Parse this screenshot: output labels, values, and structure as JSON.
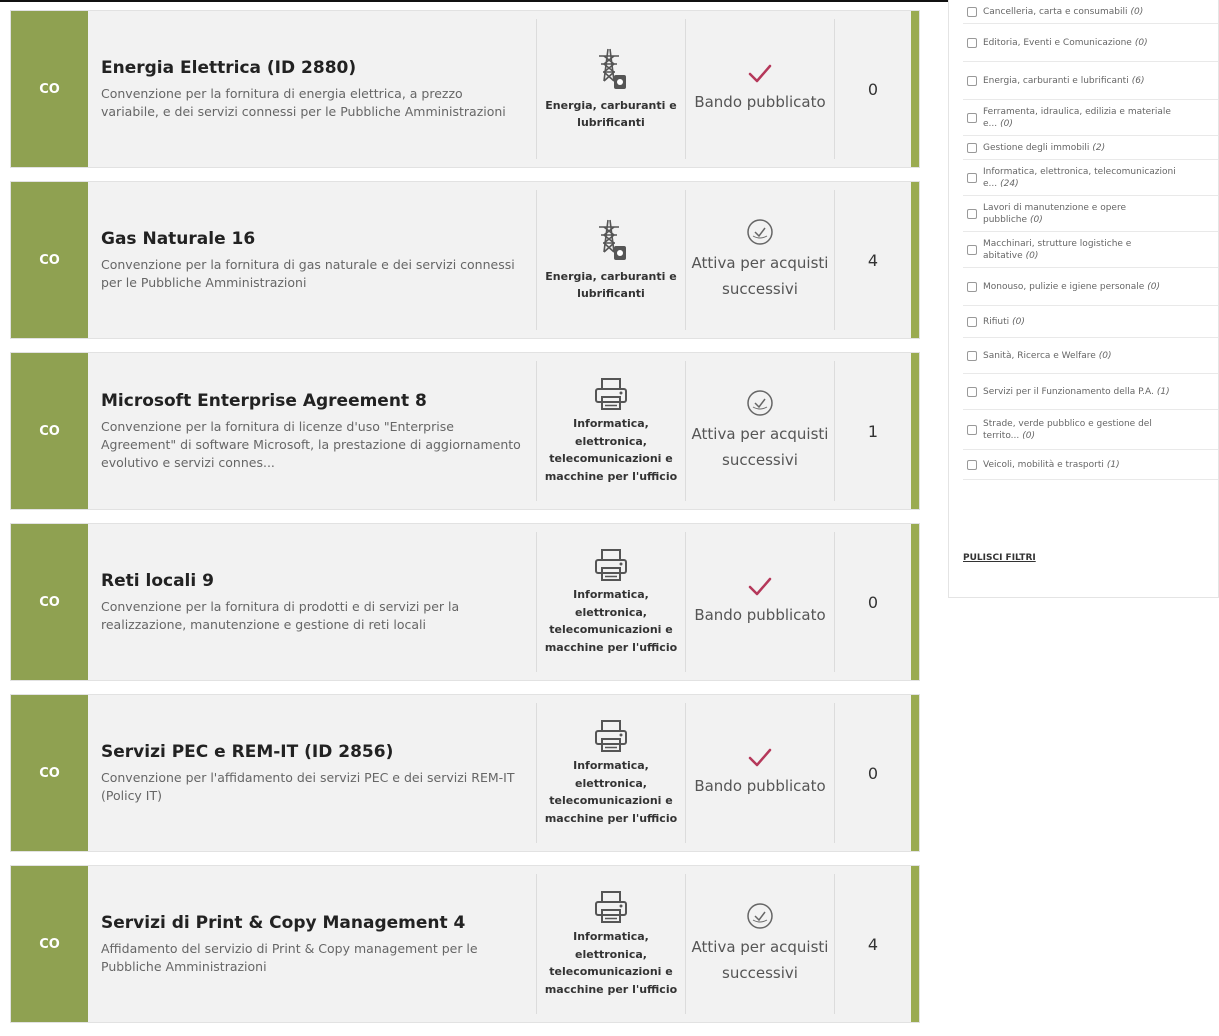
{
  "results": [
    {
      "type_code": "CO",
      "title": "Energia Elettrica (ID 2880)",
      "description": "Convenzione per la fornitura di energia elettrica, a prezzo variabile, e dei servizi connessi per le Pubbliche Amministrazioni",
      "category_icon": "power-pylon-icon",
      "category": "Energia, carburanti e lubrificanti",
      "status_icon": "check-icon",
      "status": "Bando pubblicato",
      "count": "0"
    },
    {
      "type_code": "CO",
      "title": "Gas Naturale 16",
      "description": "Convenzione per la fornitura di gas naturale e dei servizi connessi per le Pubbliche Amministrazioni",
      "category_icon": "power-pylon-icon",
      "category": "Energia, carburanti e lubrificanti",
      "status_icon": "active-badge-icon",
      "status": "Attiva per acquisti successivi",
      "count": "4"
    },
    {
      "type_code": "CO",
      "title": "Microsoft Enterprise Agreement 8",
      "description": "Convenzione per la fornitura di licenze d'uso \"Enterprise Agreement\" di software Microsoft, la prestazione di aggiornamento evolutivo e servizi connes...",
      "category_icon": "printer-icon",
      "category": "Informatica, elettronica, telecomunicazioni e macchine per l'ufficio",
      "status_icon": "active-badge-icon",
      "status": "Attiva per acquisti successivi",
      "count": "1"
    },
    {
      "type_code": "CO",
      "title": "Reti locali 9",
      "description": "Convenzione per la fornitura di prodotti e di servizi per la realizzazione, manutenzione e gestione di reti locali",
      "category_icon": "printer-icon",
      "category": "Informatica, elettronica, telecomunicazioni e macchine per l'ufficio",
      "status_icon": "check-icon",
      "status": "Bando pubblicato",
      "count": "0"
    },
    {
      "type_code": "CO",
      "title": "Servizi PEC e REM-IT (ID 2856)",
      "description": "Convenzione per l'affidamento dei servizi PEC e dei servizi REM-IT (Policy IT)",
      "category_icon": "printer-icon",
      "category": "Informatica, elettronica, telecomunicazioni e macchine per l'ufficio",
      "status_icon": "check-icon",
      "status": "Bando pubblicato",
      "count": "0"
    },
    {
      "type_code": "CO",
      "title": "Servizi di Print & Copy Management 4",
      "description": "Affidamento del servizio di Print & Copy management per le Pubbliche Amministrazioni",
      "category_icon": "printer-icon",
      "category": "Informatica, elettronica, telecomunicazioni e macchine per l'ufficio",
      "status_icon": "active-badge-icon",
      "status": "Attiva per acquisti successivi",
      "count": "4"
    }
  ],
  "filters": {
    "items": [
      {
        "label": "Cancelleria, carta e consumabili",
        "count": "(0)"
      },
      {
        "label": "Editoria, Eventi e Comunicazione",
        "count": "(0)"
      },
      {
        "label": "Energia, carburanti e lubrificanti",
        "count": "(6)"
      },
      {
        "label": "Ferramenta, idraulica, edilizia e materiale e...",
        "count": "(0)"
      },
      {
        "label": "Gestione degli immobili",
        "count": "(2)"
      },
      {
        "label": "Informatica, elettronica, telecomunicazioni e...",
        "count": "(24)"
      },
      {
        "label": "Lavori di manutenzione e opere pubbliche",
        "count": "(0)"
      },
      {
        "label": "Macchinari, strutture logistiche e abitative",
        "count": "(0)"
      },
      {
        "label": "Monouso, pulizie e igiene personale",
        "count": "(0)"
      },
      {
        "label": "Rifiuti",
        "count": "(0)"
      },
      {
        "label": "Sanità, Ricerca e Welfare",
        "count": "(0)"
      },
      {
        "label": "Servizi per il Funzionamento della P.A.",
        "count": "(1)"
      },
      {
        "label": "Strade, verde pubblico e gestione del territo...",
        "count": "(0)"
      },
      {
        "label": "Veicoli, mobilità e trasporti",
        "count": "(1)"
      }
    ],
    "clear_label": "PULISCI FILTRI"
  },
  "colors": {
    "type_badge": "#8fa151",
    "right_bar": "#9aab51",
    "check_mark": "#b5385a",
    "card_bg": "#f2f2f2"
  }
}
